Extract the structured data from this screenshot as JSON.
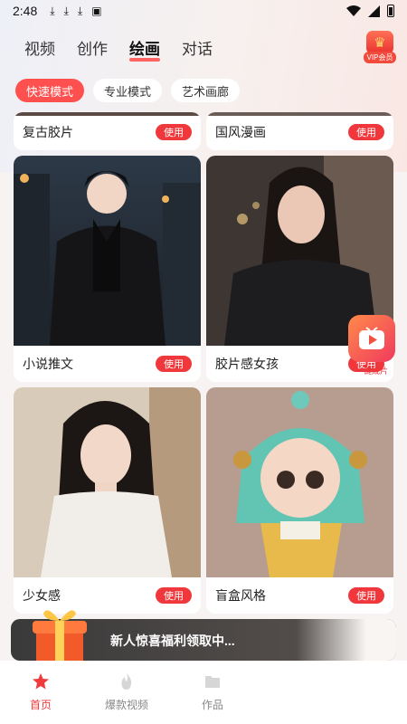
{
  "status_bar": {
    "time": "2:48"
  },
  "header": {
    "tabs": [
      {
        "label": "视频",
        "active": false
      },
      {
        "label": "创作",
        "active": false
      },
      {
        "label": "绘画",
        "active": true
      },
      {
        "label": "对话",
        "active": false
      }
    ],
    "vip_label": "VIP会员"
  },
  "modes": [
    {
      "label": "快速模式",
      "active": true
    },
    {
      "label": "专业模式",
      "active": false
    },
    {
      "label": "艺术画廊",
      "active": false
    }
  ],
  "styles": [
    {
      "label": "复古胶片",
      "button": "使用"
    },
    {
      "label": "国风漫画",
      "button": "使用"
    },
    {
      "label": "小说推文",
      "button": "使用"
    },
    {
      "label": "胶片感女孩",
      "button": "使用"
    },
    {
      "label": "少女感",
      "button": "使用"
    },
    {
      "label": "盲盒风格",
      "button": "使用"
    }
  ],
  "float_button": {
    "label": "一键成片"
  },
  "promo": {
    "text": "新人惊喜福利领取中..."
  },
  "bottom_nav": [
    {
      "label": "首页",
      "active": true
    },
    {
      "label": "爆款视频",
      "active": false
    },
    {
      "label": "作品",
      "active": false
    }
  ],
  "colors": {
    "accent": "#f0383c",
    "text": "#222222",
    "inactive": "#888888"
  }
}
